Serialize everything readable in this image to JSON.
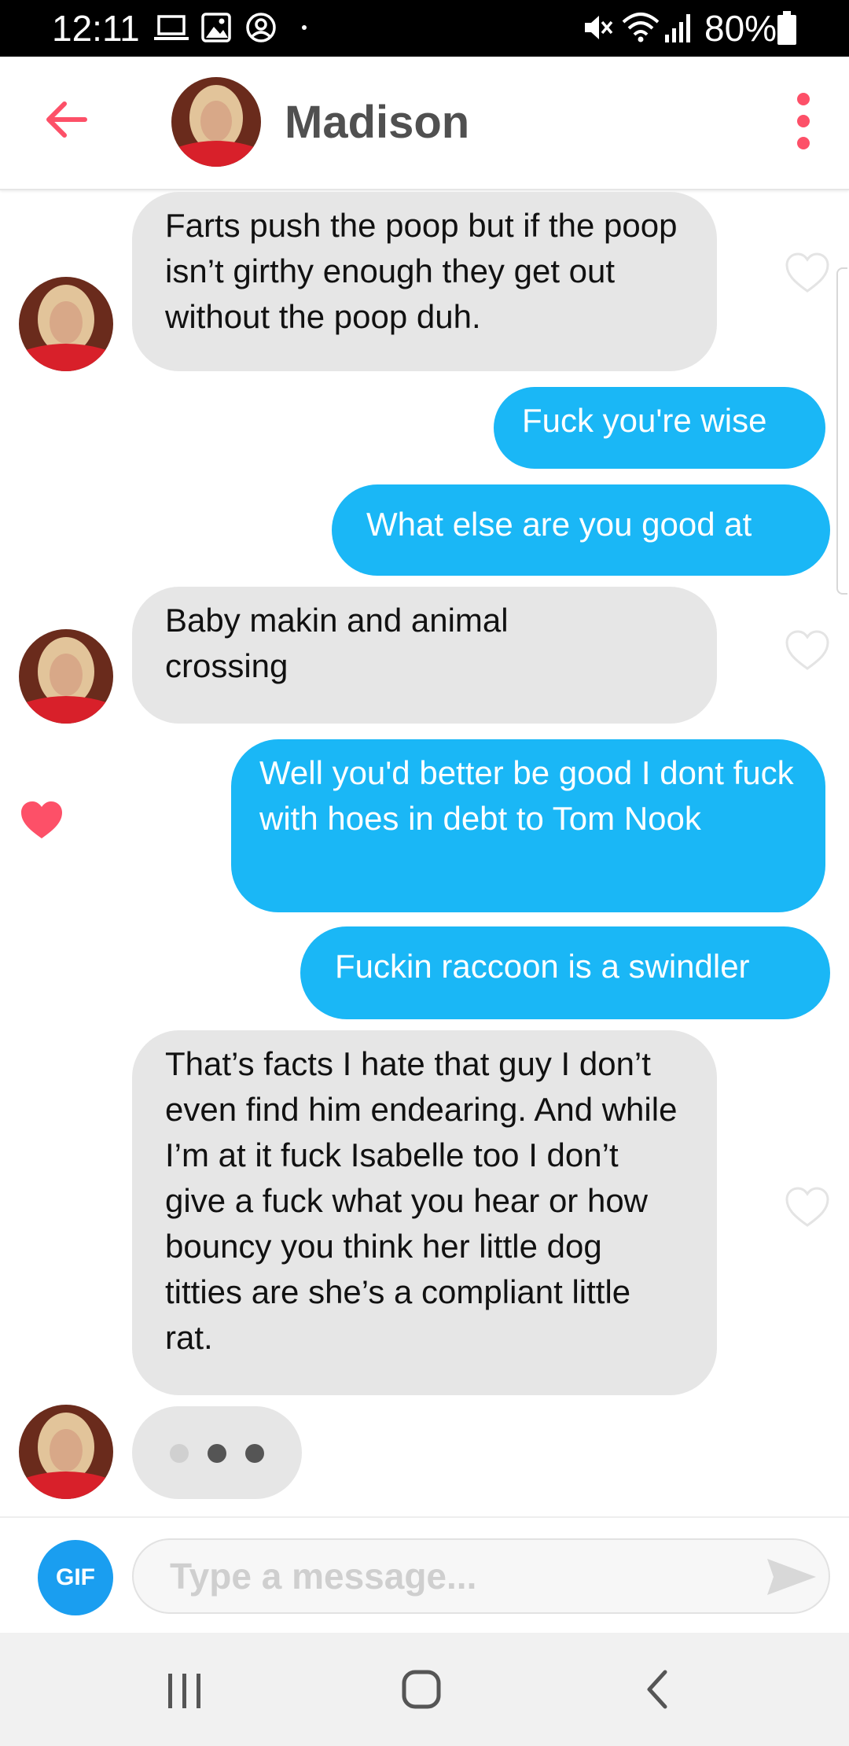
{
  "status_bar": {
    "time": "12:11",
    "battery": "80%",
    "icons": [
      "laptop-icon",
      "gallery-icon",
      "account-icon",
      "mute-icon",
      "wifi-icon",
      "signal-icon",
      "battery-icon"
    ]
  },
  "header": {
    "contact_name": "Madison",
    "back_icon": "back-arrow-icon",
    "menu_icon": "more-vertical-icon"
  },
  "colors": {
    "accent": "#fd5068",
    "outgoing": "#1ab7f6",
    "incoming": "#e6e6e6",
    "gif": "#1a9ef0"
  },
  "messages": [
    {
      "side": "in",
      "text": "Farts push the poop but if the poop isn’t girthy enough they get out without the poop duh.",
      "liked": false
    },
    {
      "side": "out",
      "text": "Fuck you're wise"
    },
    {
      "side": "out",
      "text": "What else are you good at"
    },
    {
      "side": "in",
      "text": "Baby makin and animal crossing",
      "liked": false
    },
    {
      "side": "out",
      "text": "Well you'd better be good I dont fuck with hoes in debt to Tom Nook",
      "liked": true
    },
    {
      "side": "out",
      "text": "Fuckin raccoon is a swindler"
    },
    {
      "side": "in",
      "text": "That’s facts I hate that guy I don’t even find him endearing. And while I’m at it fuck Isabelle too I don’t give a fuck what you hear or how bouncy you think her little dog titties are she’s a compliant little rat.",
      "liked": false
    },
    {
      "side": "in",
      "typing": true
    }
  ],
  "composer": {
    "gif_label": "GIF",
    "placeholder": "Type a message..."
  },
  "nav": {
    "recent": "recent-apps-icon",
    "home": "home-icon",
    "back": "back-icon"
  }
}
